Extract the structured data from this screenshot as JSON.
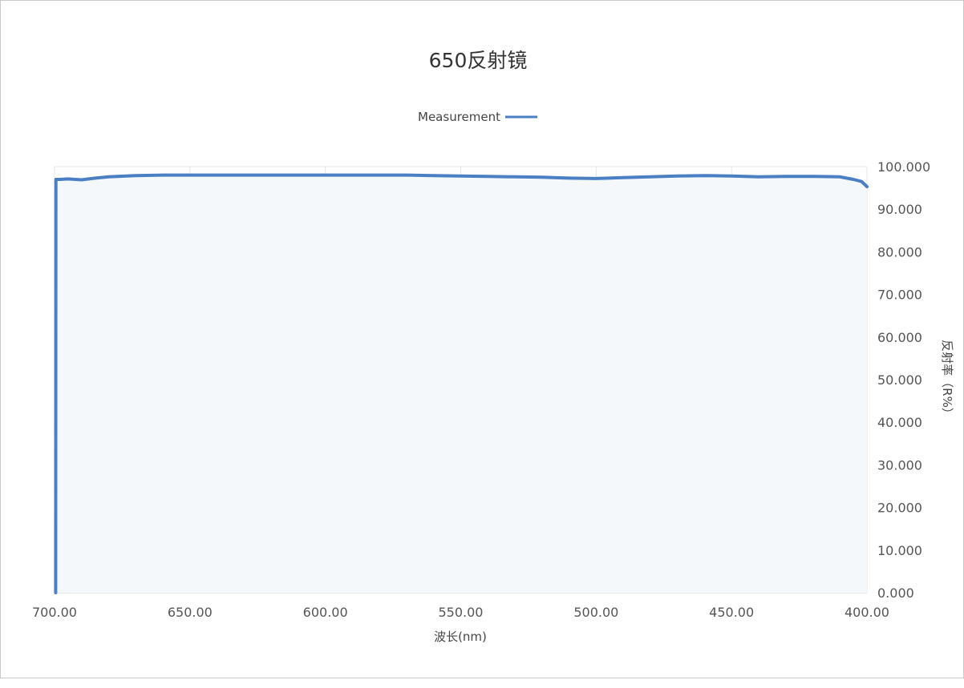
{
  "chart_data": {
    "type": "line",
    "title": "650反射镜",
    "xlabel": "波长(nm)",
    "ylabel": "反射率（R%）",
    "xlim": [
      400,
      700
    ],
    "ylim": [
      0,
      100
    ],
    "x_axis_reversed": true,
    "y_axis_side": "right",
    "legend_position": "top-center",
    "grid": true,
    "area_fill": true,
    "x_ticks": [
      "400.00",
      "450.00",
      "500.00",
      "550.00",
      "600.00",
      "650.00",
      "700.00"
    ],
    "y_ticks": [
      "0.000",
      "10.000",
      "20.000",
      "30.000",
      "40.000",
      "50.000",
      "60.000",
      "70.000",
      "80.000",
      "90.000",
      "100.000"
    ],
    "series": [
      {
        "name": "Measurement",
        "color": "#4a7fc4",
        "x": [
          400,
          402,
          405,
          410,
          420,
          430,
          440,
          450,
          460,
          470,
          480,
          490,
          500,
          510,
          520,
          530,
          540,
          550,
          560,
          570,
          580,
          590,
          600,
          610,
          620,
          630,
          640,
          650,
          660,
          670,
          680,
          685,
          690,
          695,
          698,
          699.5,
          699.6
        ],
        "y": [
          95.3,
          96.5,
          97.0,
          97.6,
          97.7,
          97.7,
          97.6,
          97.8,
          97.9,
          97.8,
          97.6,
          97.4,
          97.2,
          97.3,
          97.5,
          97.6,
          97.7,
          97.8,
          97.9,
          98.0,
          98.0,
          98.0,
          98.0,
          98.0,
          98.0,
          98.0,
          98.0,
          98.0,
          98.0,
          97.9,
          97.6,
          97.3,
          96.9,
          97.1,
          97.0,
          97.0,
          0.0
        ]
      }
    ]
  }
}
